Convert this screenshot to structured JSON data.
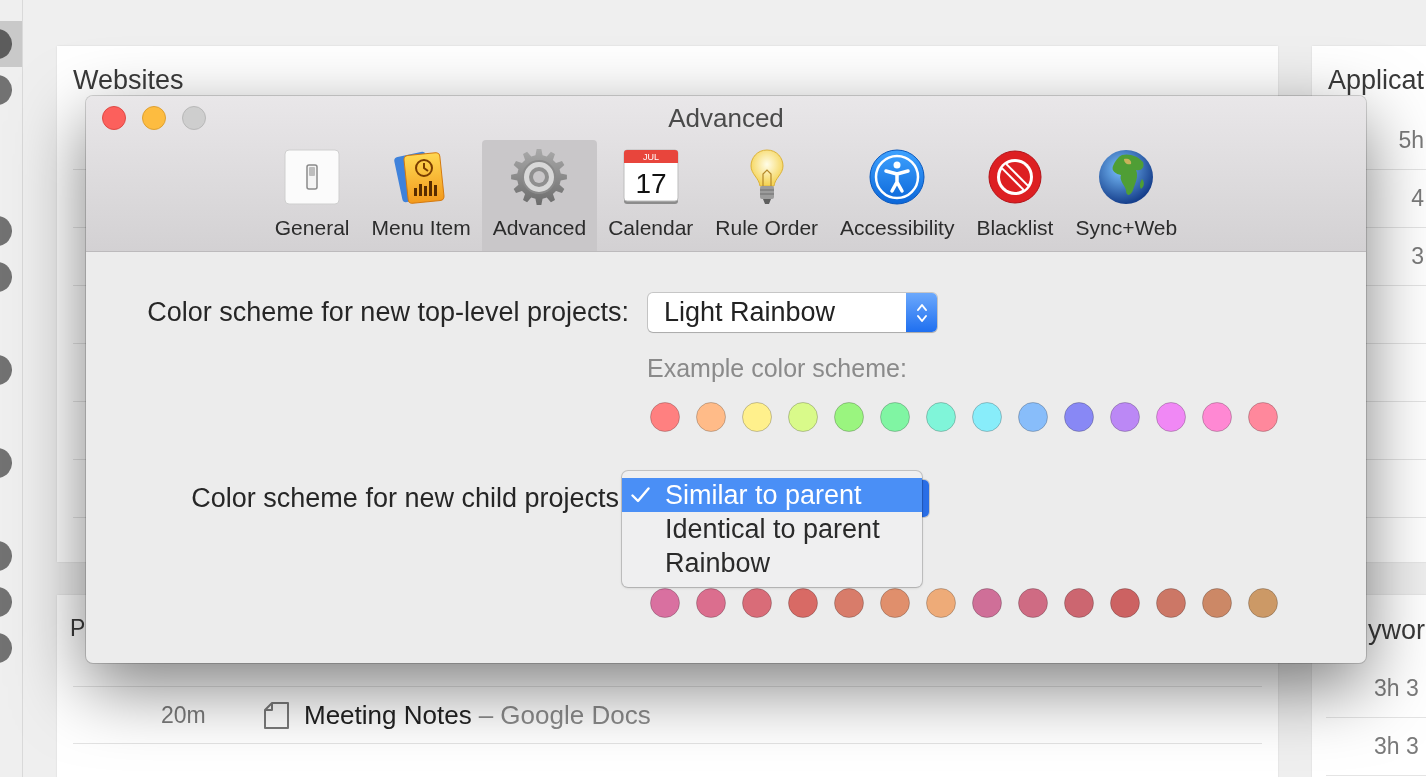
{
  "background": {
    "sidebar": {
      "groups": [
        {
          "items": [
            {
              "selected": true
            },
            {
              "selected": false
            }
          ]
        },
        {
          "items": [
            {
              "selected": false
            },
            {
              "selected": false
            }
          ]
        },
        {
          "items": [
            {
              "selected": false
            }
          ]
        },
        {
          "items": [
            {
              "selected": false
            }
          ]
        },
        {
          "items": [
            {
              "selected": false
            },
            {
              "selected": false
            },
            {
              "selected": false
            }
          ]
        }
      ]
    },
    "websites_panel": {
      "title": "Websites"
    },
    "applications_panel": {
      "title": "Applicat",
      "rows": [
        {
          "duration": "5h"
        },
        {
          "duration": "4"
        },
        {
          "duration": "3"
        }
      ]
    },
    "documents_panel": {
      "title": "P",
      "rows": [
        {
          "duration": "20m",
          "title": "Meeting Notes",
          "source": "– Google Docs"
        }
      ]
    },
    "keywords_panel": {
      "title": "ywor",
      "rows": [
        {
          "duration": "3h 3"
        },
        {
          "duration": "3h 3"
        }
      ]
    }
  },
  "preferences_window": {
    "title": "Advanced",
    "window_buttons": [
      {
        "kind": "close",
        "disabled": false
      },
      {
        "kind": "minimize",
        "disabled": false
      },
      {
        "kind": "zoom",
        "disabled": true
      }
    ],
    "toolbar": [
      {
        "label": "General",
        "selected": false
      },
      {
        "label": "Menu Item",
        "selected": false
      },
      {
        "label": "Advanced",
        "selected": true
      },
      {
        "label": "Calendar",
        "selected": false,
        "icon_text": {
          "month": "JUL",
          "day": "17"
        }
      },
      {
        "label": "Rule Order",
        "selected": false
      },
      {
        "label": "Accessibility",
        "selected": false
      },
      {
        "label": "Blacklist",
        "selected": false
      },
      {
        "label": "Sync+Web",
        "selected": false
      }
    ],
    "top_level_scheme": {
      "label": "Color scheme for new top-level projects:",
      "value": "Light Rainbow",
      "example_label": "Example color scheme:",
      "swatches": [
        {
          "color": "#ff8080"
        },
        {
          "color": "#ffbb88"
        },
        {
          "color": "#fff08c"
        },
        {
          "color": "#d9fa8a"
        },
        {
          "color": "#9af57f"
        },
        {
          "color": "#80f5a3"
        },
        {
          "color": "#80f5d9"
        },
        {
          "color": "#88edfa"
        },
        {
          "color": "#88bdfa"
        },
        {
          "color": "#8888f5"
        },
        {
          "color": "#bb88f5"
        },
        {
          "color": "#f088f5"
        },
        {
          "color": "#ff88d3"
        },
        {
          "color": "#ff889c"
        }
      ]
    },
    "child_scheme": {
      "label": "Color scheme for new child projects",
      "menu": [
        {
          "label": "Similar to parent",
          "selected": true
        },
        {
          "label": "Identical to parent",
          "selected": false
        },
        {
          "label": "Rainbow",
          "selected": false
        }
      ],
      "swatches": [
        {
          "color": "#d970a0"
        },
        {
          "color": "#db6e8e"
        },
        {
          "color": "#d96c78"
        },
        {
          "color": "#d86a65"
        },
        {
          "color": "#d87c6a"
        },
        {
          "color": "#e08f6c"
        },
        {
          "color": "#eeab78"
        },
        {
          "color": "#cf6f98"
        },
        {
          "color": "#cf6b83"
        },
        {
          "color": "#cc6670"
        },
        {
          "color": "#cc6262"
        },
        {
          "color": "#cc7766"
        },
        {
          "color": "#cc8866"
        },
        {
          "color": "#cc9966"
        }
      ]
    }
  }
}
